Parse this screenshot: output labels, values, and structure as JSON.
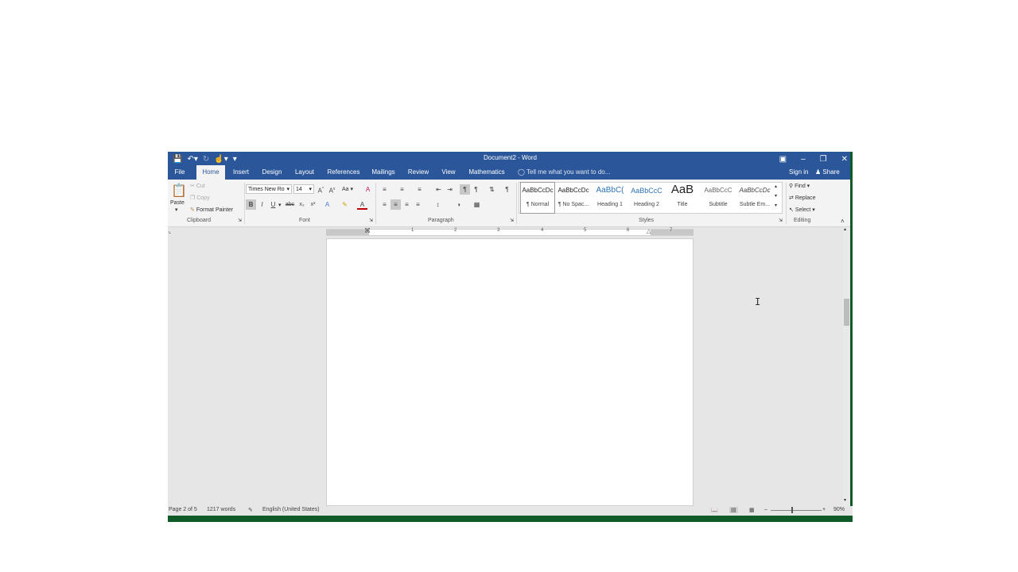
{
  "window": {
    "title": "Document2 - Word"
  },
  "qat": {
    "save_icon": "save-icon",
    "undo_icon": "undo-icon",
    "redo_icon": "redo-icon",
    "touch_icon": "touch-mode-icon",
    "customize_icon": "customize-icon"
  },
  "window_controls": {
    "ribbon_options": "ribbon-display-icon",
    "minimize": "minimize-icon",
    "restore": "restore-icon",
    "close": "close-icon"
  },
  "tabs": [
    {
      "label": "File"
    },
    {
      "label": "Home"
    },
    {
      "label": "Insert"
    },
    {
      "label": "Design"
    },
    {
      "label": "Layout"
    },
    {
      "label": "References"
    },
    {
      "label": "Mailings"
    },
    {
      "label": "Review"
    },
    {
      "label": "View"
    },
    {
      "label": "Mathematics"
    }
  ],
  "tell_me": "Tell me what you want to do...",
  "sign_in": "Sign in",
  "share": "Share",
  "clipboard": {
    "paste": "Paste",
    "cut": "Cut",
    "copy": "Copy",
    "format_painter": "Format Painter",
    "label": "Clipboard"
  },
  "font": {
    "name": "Times New Ro",
    "size": "14",
    "case": "Aa",
    "label": "Font",
    "bold": "B",
    "italic": "I",
    "underline": "U",
    "strike": "abc",
    "sub": "x₂",
    "sup": "x²"
  },
  "paragraph": {
    "label": "Paragraph"
  },
  "styles": {
    "label": "Styles",
    "items": [
      {
        "preview": "AaBbCcDc",
        "name": "¶ Normal"
      },
      {
        "preview": "AaBbCcDc",
        "name": "¶ No Spac..."
      },
      {
        "preview": "AaBbC(",
        "name": "Heading 1"
      },
      {
        "preview": "AaBbCcC",
        "name": "Heading 2"
      },
      {
        "preview": "AaB",
        "name": "Title"
      },
      {
        "preview": "AaBbCcC",
        "name": "Subtitle"
      },
      {
        "preview": "AaBbCcDc",
        "name": "Subtle Em..."
      }
    ]
  },
  "editing": {
    "find": "Find",
    "replace": "Replace",
    "select": "Select",
    "label": "Editing"
  },
  "ruler": {
    "numbers": [
      "1",
      "2",
      "3",
      "4",
      "5",
      "6",
      "7"
    ]
  },
  "status": {
    "page": "Page 2 of 5",
    "words": "1217 words",
    "language": "English (United States)",
    "zoom": "90%"
  }
}
